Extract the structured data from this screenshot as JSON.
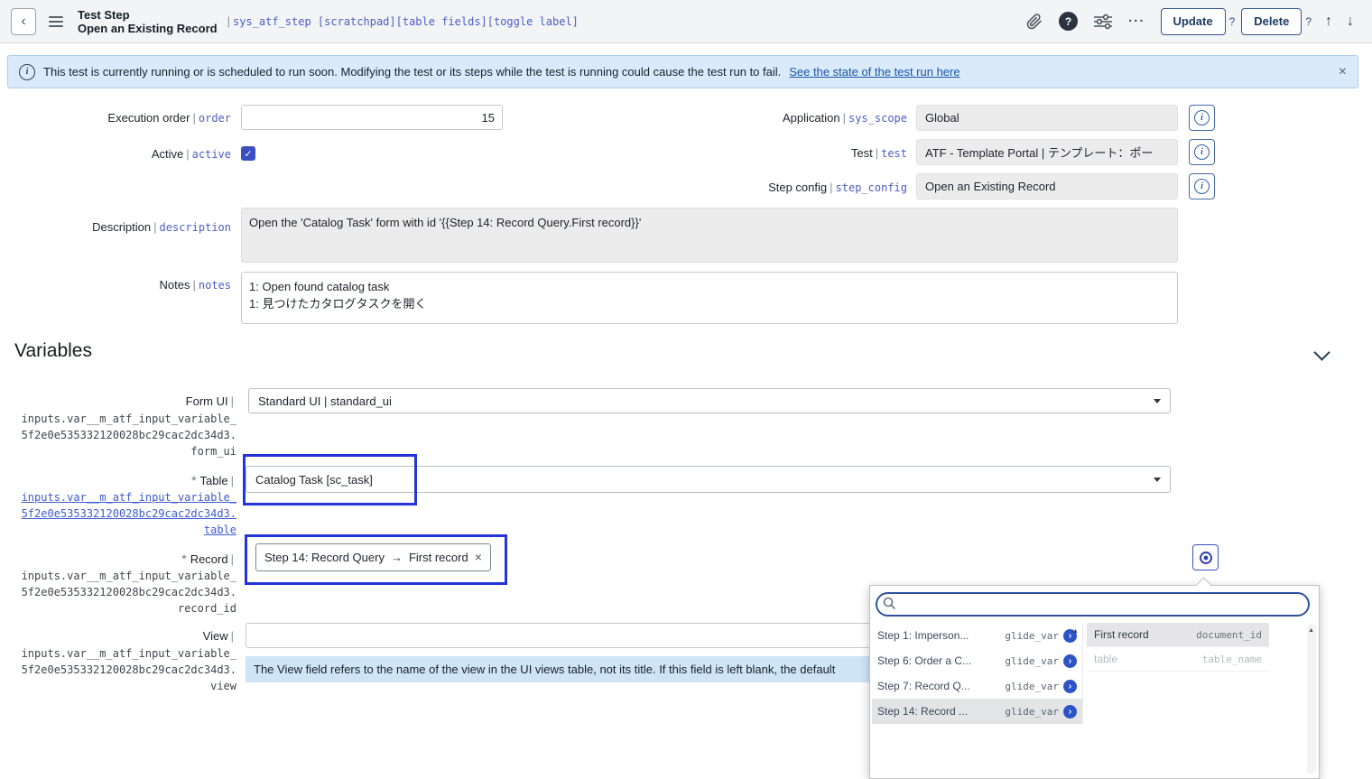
{
  "ui": {
    "pipe": "|",
    "back": "‹",
    "close": "×",
    "check": "✓",
    "up_arrow": "↑",
    "down_arrow": "↓",
    "more": "...",
    "asterisk": "*",
    "pill_arrow": "→",
    "remove": "×",
    "scroll_up": "▲",
    "info": "i",
    "help": "?"
  },
  "colors": {
    "annotation_accent": "#2434d8",
    "link": "#1756a9",
    "mono_blue": "#4a5ec5",
    "banner_bg": "#dbeafa",
    "checkbox": "#3c4fc2"
  },
  "header": {
    "record_type": "Test Step",
    "record_title": "Open an Existing Record",
    "table": "sys_atf_step",
    "table_annotations": "[scratchpad][table fields][toggle label]",
    "update": "Update",
    "update_help": "?",
    "delete": "Delete",
    "delete_help": "?"
  },
  "banner": {
    "message": "This test is currently running or is scheduled to run soon. Modifying the test or its steps while the test is running could cause the test run to fail.",
    "link": "See the state of the test run here"
  },
  "form": {
    "execution_order": {
      "label": "Execution order",
      "name": "order",
      "value": "15"
    },
    "active": {
      "label": "Active",
      "name": "active",
      "checked": true
    },
    "application": {
      "label": "Application",
      "name": "sys_scope",
      "value": "Global"
    },
    "test": {
      "label": "Test",
      "name": "test",
      "value": "ATF - Template Portal | テンプレート：ポー"
    },
    "step_config": {
      "label": "Step config",
      "name": "step_config",
      "value": "Open an Existing Record"
    },
    "description": {
      "label": "Description",
      "name": "description",
      "value": "Open the 'Catalog Task' form with id '{{Step 14: Record Query.First record}}'"
    },
    "notes": {
      "label": "Notes",
      "name": "notes",
      "line1": "1: Open found catalog task",
      "line2": "1: 見つけたカタログタスクを開く"
    }
  },
  "variables": {
    "heading": "Variables",
    "form_ui": {
      "label": "Form UI",
      "path1": "inputs.var__m_atf_input_variable_",
      "path2": "5f2e0e535332120028bc29cac2dc34d3.",
      "path3": "form_ui",
      "value": "Standard UI | standard_ui"
    },
    "table": {
      "label": "Table",
      "path1": "inputs.var__m_atf_input_variable_",
      "path2": "5f2e0e535332120028bc29cac2dc34d3.",
      "path3": "table",
      "value": "Catalog Task [sc_task]"
    },
    "record": {
      "label": "Record",
      "path1": "inputs.var__m_atf_input_variable_",
      "path2": "5f2e0e535332120028bc29cac2dc34d3.",
      "path3": "record_id",
      "pill_source": "Step 14: Record Query",
      "pill_field": "First record"
    },
    "view": {
      "label": "View",
      "path1": "inputs.var__m_atf_input_variable_",
      "path2": "5f2e0e535332120028bc29cac2dc34d3.",
      "path3": "view",
      "value": "",
      "help": "The View field refers to the name of the view in the UI views table, not its title. If this field is left blank, the default"
    }
  },
  "popup": {
    "steps": [
      {
        "label": "Step 1: Imperson...",
        "type": "glide_var"
      },
      {
        "label": "Step 6: Order a C...",
        "type": "glide_var"
      },
      {
        "label": "Step 7: Record Q...",
        "type": "glide_var"
      },
      {
        "label": "Step 14: Record ...",
        "type": "glide_var"
      }
    ],
    "fields": [
      {
        "label": "First record",
        "name": "document_id"
      },
      {
        "label": "table",
        "name": "table_name"
      }
    ]
  }
}
